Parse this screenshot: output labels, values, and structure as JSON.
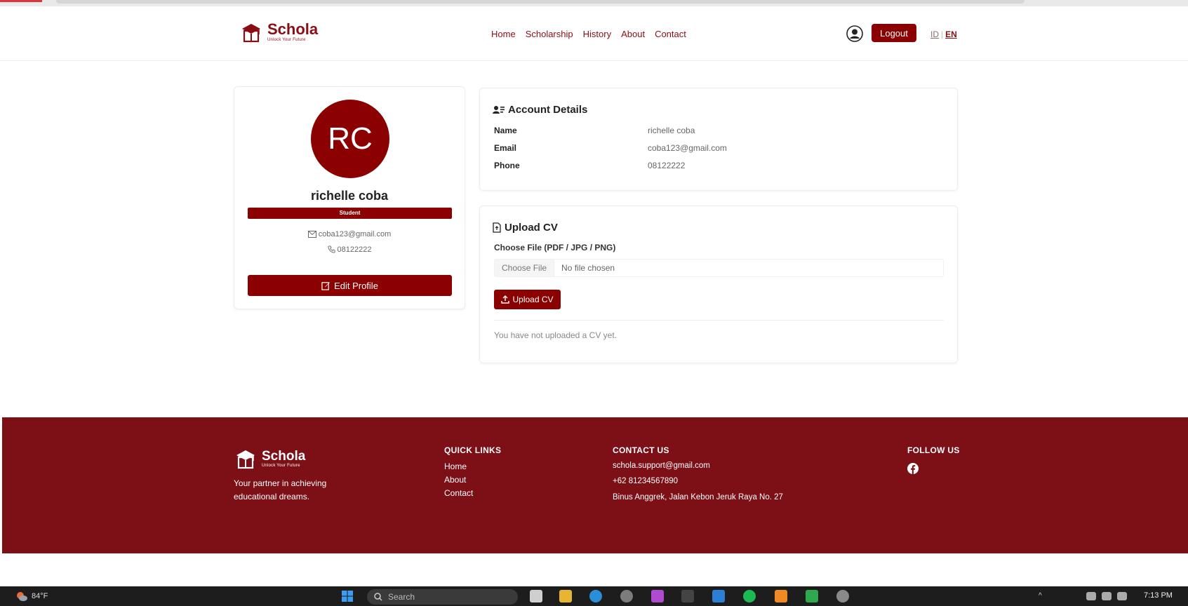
{
  "brand": {
    "name": "Schola",
    "tagline": "Unlock Your Future"
  },
  "nav": {
    "links": [
      "Home",
      "Scholarship",
      "History",
      "About",
      "Contact"
    ],
    "logout_label": "Logout",
    "lang_id": "ID",
    "lang_sep": "|",
    "lang_en": "EN"
  },
  "profile": {
    "initials": "RC",
    "name": "richelle coba",
    "role": "Student",
    "email": "coba123@gmail.com",
    "phone": "08122222",
    "edit_label": "Edit Profile"
  },
  "account": {
    "title": "Account Details",
    "rows": [
      {
        "label": "Name",
        "value": "richelle coba"
      },
      {
        "label": "Email",
        "value": "coba123@gmail.com"
      },
      {
        "label": "Phone",
        "value": "08122222"
      }
    ]
  },
  "cv": {
    "title": "Upload CV",
    "file_label": "Choose File (PDF / JPG / PNG)",
    "choose_button": "Choose File",
    "no_file": "No file chosen",
    "upload_label": "Upload CV",
    "status": "You have not uploaded a CV yet."
  },
  "footer": {
    "description": "Your partner in achieving educational dreams.",
    "quick_links_title": "QUICK LINKS",
    "quick_links": [
      "Home",
      "About",
      "Contact"
    ],
    "contact_title": "CONTACT US",
    "contact": [
      "schola.support@gmail.com",
      "+62 81234567890",
      "Binus Anggrek, Jalan Kebon Jeruk Raya No. 27"
    ],
    "follow_title": "FOLLOW US"
  },
  "taskbar": {
    "temperature": "84°F",
    "search_placeholder": "Search",
    "time": "7:13 PM"
  },
  "colors": {
    "brand": "#8b0000",
    "footer": "#7d0f17"
  }
}
